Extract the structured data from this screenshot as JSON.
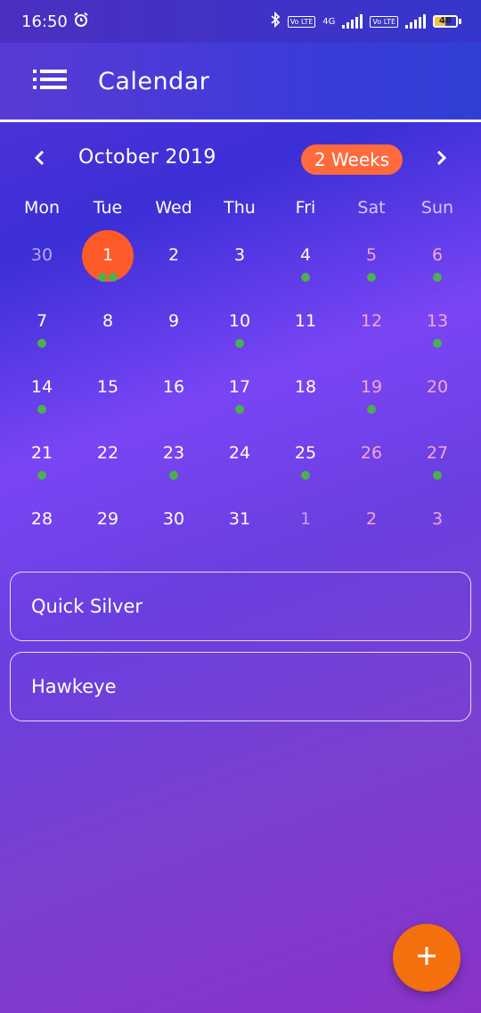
{
  "status_bar": {
    "time": "16:50",
    "network": "4G",
    "volte": "Vo LTE",
    "battery": "48",
    "battery_level": 0.48
  },
  "app_bar": {
    "title": "Calendar"
  },
  "calendar": {
    "month_label": "October 2019",
    "format_button": "2 Weeks",
    "weekdays": [
      "Mon",
      "Tue",
      "Wed",
      "Thu",
      "Fri",
      "Sat",
      "Sun"
    ],
    "weeks": [
      [
        {
          "d": "30",
          "muted": true,
          "dots": 0
        },
        {
          "d": "1",
          "selected": true,
          "dots": 2
        },
        {
          "d": "2",
          "dots": 0
        },
        {
          "d": "3",
          "dots": 0
        },
        {
          "d": "4",
          "dots": 1
        },
        {
          "d": "5",
          "weekend": true,
          "dots": 1
        },
        {
          "d": "6",
          "weekend": true,
          "dots": 1
        }
      ],
      [
        {
          "d": "7",
          "dots": 1
        },
        {
          "d": "8",
          "dots": 0
        },
        {
          "d": "9",
          "dots": 0
        },
        {
          "d": "10",
          "dots": 1
        },
        {
          "d": "11",
          "dots": 0
        },
        {
          "d": "12",
          "weekend": true,
          "dots": 0
        },
        {
          "d": "13",
          "weekend": true,
          "dots": 1
        }
      ],
      [
        {
          "d": "14",
          "dots": 1
        },
        {
          "d": "15",
          "dots": 0
        },
        {
          "d": "16",
          "dots": 0
        },
        {
          "d": "17",
          "dots": 1
        },
        {
          "d": "18",
          "dots": 0
        },
        {
          "d": "19",
          "weekend": true,
          "dots": 1
        },
        {
          "d": "20",
          "weekend": true,
          "dots": 0
        }
      ],
      [
        {
          "d": "21",
          "dots": 1
        },
        {
          "d": "22",
          "dots": 0
        },
        {
          "d": "23",
          "dots": 1
        },
        {
          "d": "24",
          "dots": 0
        },
        {
          "d": "25",
          "dots": 1
        },
        {
          "d": "26",
          "weekend": true,
          "dots": 0
        },
        {
          "d": "27",
          "weekend": true,
          "dots": 1
        }
      ],
      [
        {
          "d": "28",
          "dots": 0
        },
        {
          "d": "29",
          "dots": 0
        },
        {
          "d": "30",
          "dots": 0
        },
        {
          "d": "31",
          "dots": 0
        },
        {
          "d": "1",
          "muted": true,
          "dots": 0
        },
        {
          "d": "2",
          "muted": true,
          "weekend": true,
          "dots": 0
        },
        {
          "d": "3",
          "muted": true,
          "weekend": true,
          "dots": 0
        }
      ]
    ]
  },
  "events": [
    {
      "title": "Quick Silver"
    },
    {
      "title": "Hawkeye"
    }
  ],
  "colors": {
    "accent": "#ff5a2a",
    "fab": "#f4700c",
    "event_dot": "#4caf50"
  },
  "icons": {
    "menu": "menu-list-icon",
    "prev": "chevron-left-icon",
    "next": "chevron-right-icon",
    "fab": "plus-icon"
  }
}
